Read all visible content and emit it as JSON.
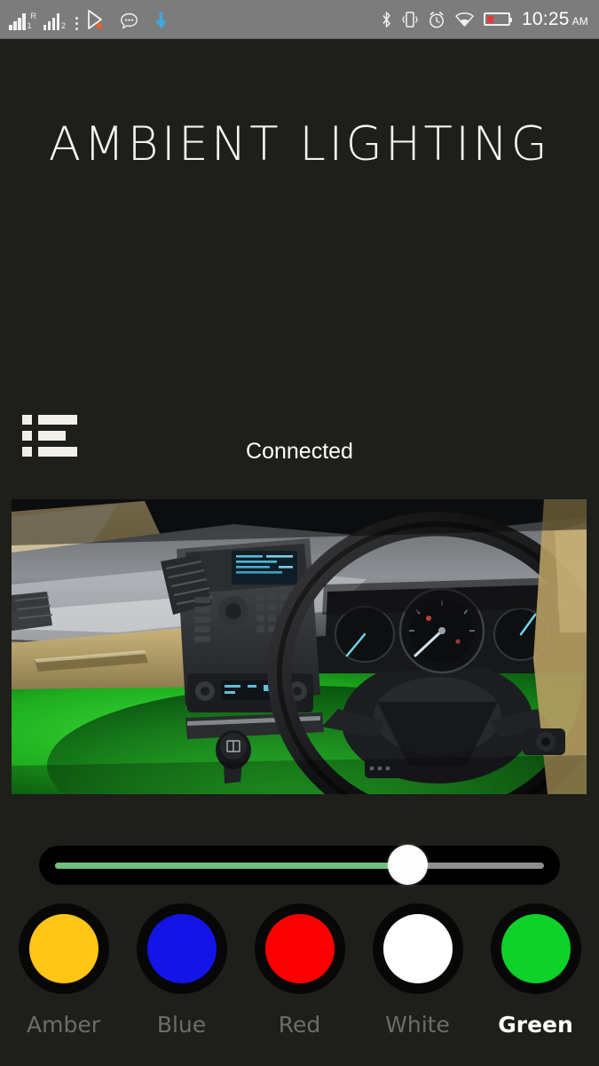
{
  "statusbar": {
    "signal1_label": "1",
    "roaming_label": "R",
    "signal2_label": "2",
    "time": "10:25",
    "ampm": "AM",
    "icons": [
      "signal-bars-sim1-icon",
      "signal-bars-sim2-roaming-icon",
      "overflow-menu-icon",
      "play-store-icon",
      "messaging-icon",
      "download-icon",
      "bluetooth-icon",
      "vibrate-icon",
      "alarm-icon",
      "wifi-icon",
      "battery-low-icon"
    ],
    "battery_level_percent": 32,
    "battery_color": "#e53935"
  },
  "app": {
    "title": "AMBIENT LIGHTING",
    "background_color": "#1e1e1a",
    "connection_status": "Connected",
    "menu_icon": "list-menu-icon"
  },
  "preview": {
    "alt": "car-interior-dashboard-with-green-ambient-footwell-lighting",
    "ambient_color": "#1faf1f"
  },
  "brightness": {
    "value_percent": 72,
    "fill_color": "#6ec07a",
    "track_color": "#8e8e8e",
    "thumb_color": "#fdfdfd"
  },
  "colors": {
    "selected": "Green",
    "options": [
      {
        "label": "Amber",
        "hex": "#ffc517"
      },
      {
        "label": "Blue",
        "hex": "#1414e6"
      },
      {
        "label": "Red",
        "hex": "#fb0000"
      },
      {
        "label": "White",
        "hex": "#ffffff"
      },
      {
        "label": "Green",
        "hex": "#0ed12a"
      }
    ]
  }
}
